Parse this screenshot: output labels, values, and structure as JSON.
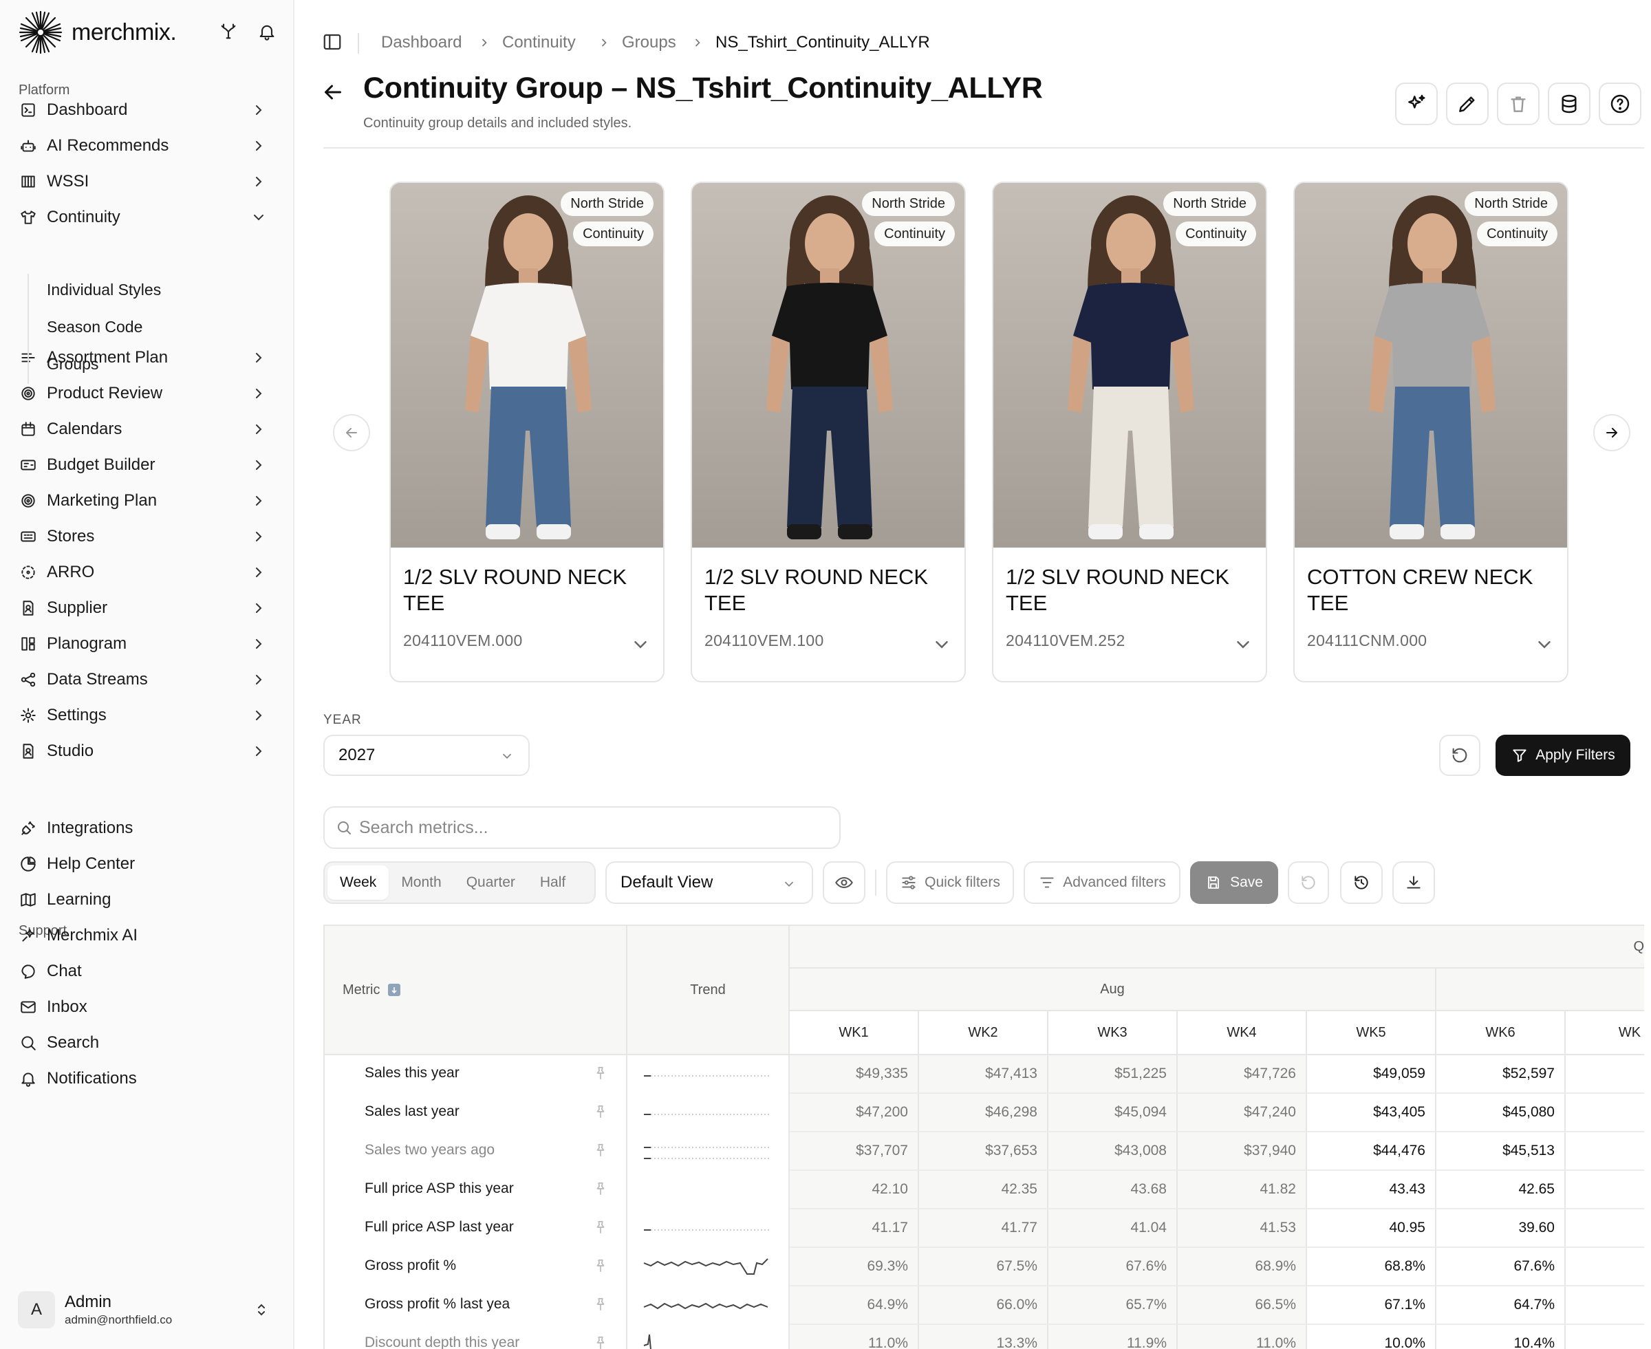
{
  "brand": {
    "name": "merchmix."
  },
  "sidebar": {
    "platform_label": "Platform",
    "support_label": "Support",
    "items": [
      {
        "label": "Dashboard",
        "icon": "dashboard-icon"
      },
      {
        "label": "AI Recommends",
        "icon": "robot-icon"
      },
      {
        "label": "WSSI",
        "icon": "columns-icon"
      },
      {
        "label": "Continuity",
        "icon": "shirt-icon"
      },
      {
        "label": "Assortment Plan",
        "icon": "list-icon"
      },
      {
        "label": "Product Review",
        "icon": "target-icon"
      },
      {
        "label": "Calendars",
        "icon": "calendar-icon"
      },
      {
        "label": "Budget Builder",
        "icon": "budget-icon"
      },
      {
        "label": "Marketing Plan",
        "icon": "target-icon"
      },
      {
        "label": "Stores",
        "icon": "store-icon"
      },
      {
        "label": "ARRO",
        "icon": "dashed-circle-icon"
      },
      {
        "label": "Supplier",
        "icon": "supplier-icon"
      },
      {
        "label": "Planogram",
        "icon": "planogram-icon"
      },
      {
        "label": "Data Streams",
        "icon": "share-icon"
      },
      {
        "label": "Settings",
        "icon": "gear-icon"
      },
      {
        "label": "Studio",
        "icon": "studio-icon"
      }
    ],
    "continuity_sub": [
      "Individual Styles",
      "Season Code",
      "Groups"
    ],
    "support_items": [
      {
        "label": "Integrations",
        "icon": "plug-icon"
      },
      {
        "label": "Help Center",
        "icon": "help-center-icon"
      },
      {
        "label": "Learning",
        "icon": "map-icon"
      },
      {
        "label": "Merchmix AI",
        "icon": "sparkle-icon"
      },
      {
        "label": "Chat",
        "icon": "chat-icon"
      },
      {
        "label": "Inbox",
        "icon": "mail-icon"
      },
      {
        "label": "Search",
        "icon": "search-icon"
      },
      {
        "label": "Notifications",
        "icon": "bell-icon"
      }
    ],
    "user": {
      "initial": "A",
      "name": "Admin",
      "email": "admin@northfield.co"
    }
  },
  "breadcrumb": [
    "Dashboard",
    "Continuity",
    "Groups",
    "NS_Tshirt_Continuity_ALLYR"
  ],
  "page": {
    "title": "Continuity Group – NS_Tshirt_Continuity_ALLYR",
    "subtitle": "Continuity group details and included styles."
  },
  "cards": [
    {
      "brand": "North Stride",
      "tag": "Continuity",
      "name": "1/2 SLV ROUND NECK TEE",
      "code": "204110VEM.000",
      "shirt": "#f4f3f1",
      "pants": "#4a6b93",
      "shoes": "#f2f2f2"
    },
    {
      "brand": "North Stride",
      "tag": "Continuity",
      "name": "1/2 SLV ROUND NECK TEE",
      "code": "204110VEM.100",
      "shirt": "#161616",
      "pants": "#1e2a44",
      "shoes": "#1a1a1a"
    },
    {
      "brand": "North Stride",
      "tag": "Continuity",
      "name": "1/2 SLV ROUND NECK TEE",
      "code": "204110VEM.252",
      "shirt": "#1b2340",
      "pants": "#e9e5dc",
      "shoes": "#f2f2f2"
    },
    {
      "brand": "North Stride",
      "tag": "Continuity",
      "name": "COTTON CREW NECK TEE",
      "code": "204111CNM.000",
      "shirt": "#a8a8a8",
      "pants": "#4c6e96",
      "shoes": "#f2f2f2"
    }
  ],
  "filters": {
    "year_label": "YEAR",
    "year_value": "2027",
    "apply_label": "Apply Filters",
    "search_placeholder": "Search metrics...",
    "periods": [
      "Week",
      "Month",
      "Quarter",
      "Half"
    ],
    "active_period": "Week",
    "view": "Default View",
    "quick_filters": "Quick filters",
    "advanced_filters": "Advanced filters",
    "save": "Save"
  },
  "table": {
    "metric_header": "Metric",
    "trend_header": "Trend",
    "month": "Aug",
    "quarter_partial": "Q",
    "weeks": [
      "WK1",
      "WK2",
      "WK3",
      "WK4",
      "WK5",
      "WK6",
      "WK"
    ],
    "rows": [
      {
        "metric": "Sales this year",
        "muted": false,
        "trend": "flat",
        "values": [
          "$49,335",
          "$47,413",
          "$51,225",
          "$47,726",
          "$49,059",
          "$52,597",
          "$"
        ]
      },
      {
        "metric": "Sales last year",
        "muted": false,
        "trend": "flat",
        "values": [
          "$47,200",
          "$46,298",
          "$45,094",
          "$47,240",
          "$43,405",
          "$45,080",
          "$"
        ]
      },
      {
        "metric": "Sales two years ago",
        "muted": true,
        "trend": "flat2",
        "values": [
          "$37,707",
          "$37,653",
          "$43,008",
          "$37,940",
          "$44,476",
          "$45,513",
          "$"
        ]
      },
      {
        "metric": "Full price ASP this year",
        "muted": false,
        "trend": "none",
        "values": [
          "42.10",
          "42.35",
          "43.68",
          "41.82",
          "43.43",
          "42.65",
          ""
        ]
      },
      {
        "metric": "Full price ASP last year",
        "muted": false,
        "trend": "flat",
        "values": [
          "41.17",
          "41.77",
          "41.04",
          "41.53",
          "40.95",
          "39.60",
          ""
        ]
      },
      {
        "metric": "Gross profit %",
        "muted": false,
        "trend": "wavy",
        "values": [
          "69.3%",
          "67.5%",
          "67.6%",
          "68.9%",
          "68.8%",
          "67.6%",
          ""
        ]
      },
      {
        "metric": "Gross profit % last yea",
        "muted": false,
        "trend": "wavy2",
        "values": [
          "64.9%",
          "66.0%",
          "65.7%",
          "66.5%",
          "67.1%",
          "64.7%",
          ""
        ]
      },
      {
        "metric": "Discount depth this year",
        "muted": true,
        "trend": "spike",
        "values": [
          "11.0%",
          "13.3%",
          "11.9%",
          "11.0%",
          "10.0%",
          "10.4%",
          ""
        ]
      }
    ]
  }
}
